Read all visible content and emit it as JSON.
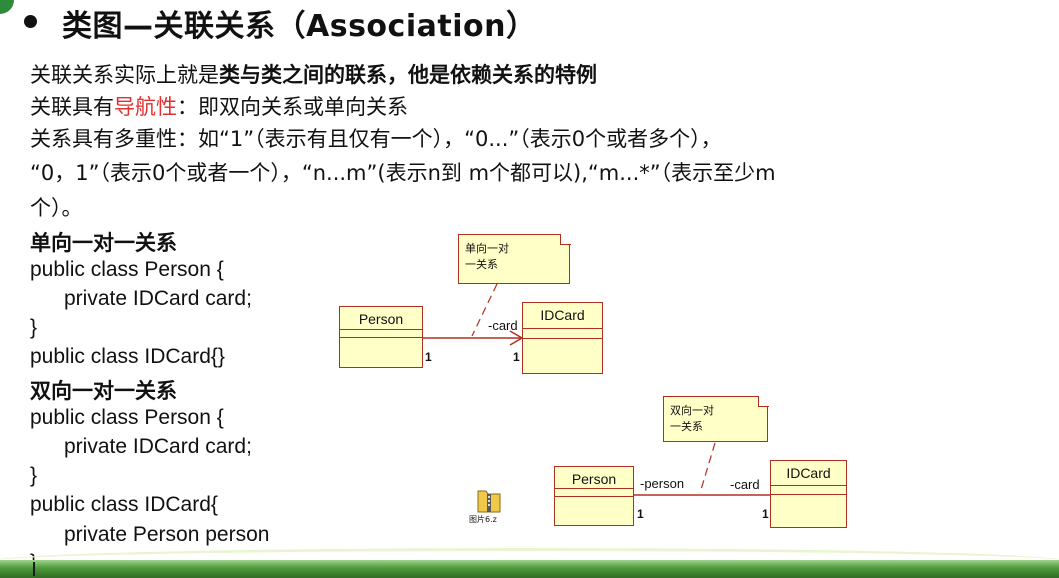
{
  "slide": {
    "title": "类图—关联关系（Association）",
    "lines": {
      "l1_normal": "关联关系实际上就是",
      "l1_bold": "类与类之间的联系，他是依赖关系的特例",
      "l2_pre": "关联具有",
      "l2_red": "导航性",
      "l2_post": "：即双向关系或单向关系",
      "l3": "关系具有多重性：如“1”（表示有且仅有一个），“0...”（表示0个或者多个），",
      "l4": "“0，1”（表示0个或者一个），“n...m”(表示n到 m个都可以),“m...*”（表示至少m",
      "l5": "个）。"
    },
    "one_way": {
      "heading": "单向一对一关系",
      "code": [
        "public class Person {",
        "private IDCard card;",
        "}",
        "public class IDCard{}"
      ]
    },
    "two_way": {
      "heading": "双向一对一关系",
      "code": [
        "public class Person {",
        "private IDCard card;",
        "}",
        "public class IDCard{",
        "private Person person",
        "}"
      ]
    },
    "diagram1": {
      "note": [
        "单向一对",
        "一关系"
      ],
      "class_a": "Person",
      "class_b": "IDCard",
      "role": "-card",
      "mult_a": "1",
      "mult_b": "1"
    },
    "diagram2": {
      "note": [
        "双向一对",
        "一关系"
      ],
      "class_a": "Person",
      "class_b": "IDCard",
      "role_a": "-person",
      "role_b": "-card",
      "mult_a": "1",
      "mult_b": "1"
    },
    "file_icon": {
      "icon": "folder-zip-icon",
      "caption": "图片6.z"
    }
  },
  "colors": {
    "accent_red": "#e03030",
    "uml_fill": "#ffffc8",
    "uml_border": "#b03020",
    "footer_green": "#4d9a3a"
  }
}
